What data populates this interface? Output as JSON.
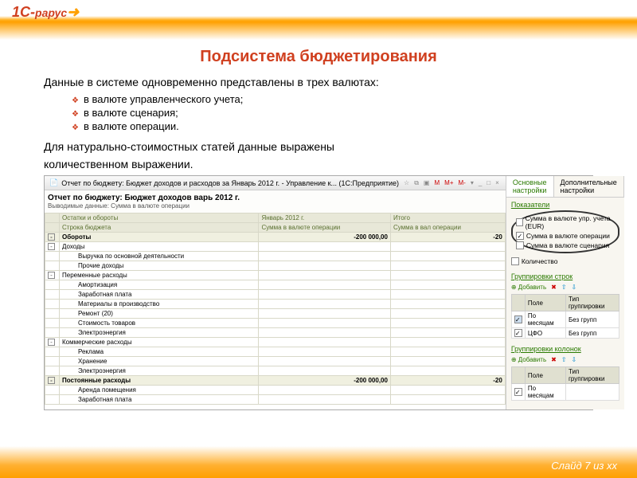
{
  "logo": {
    "main": "1С",
    "sub": "рарус"
  },
  "title": "Подсистема бюджетирования",
  "lead": "Данные в системе одновременно представлены в трех валютах:",
  "bullets": [
    "в валюте управленческого учета;",
    "в валюте сценария;",
    "в валюте операции."
  ],
  "lead2a": "Для натурально-стоимостных статей данные выражены",
  "lead2b": "количественном выражении.",
  "win": {
    "title": "Отчет по бюджету: Бюджет доходов и расходов за Январь 2012 г. - Управление к... (1С:Предприятие)",
    "icons": [
      "☆",
      "⧉",
      "▣",
      "M",
      "M+",
      "M-",
      "▾",
      "_",
      "□",
      "×"
    ]
  },
  "report": {
    "title": "Отчет по бюджету: Бюджет доходов варь 2012 г.",
    "sub": "Выводимые данные: Сумма в валюте операции",
    "cols": {
      "c1": "Остатки и обороты",
      "c2": "Январь 2012 г.",
      "c3": "Итого"
    },
    "cols2": {
      "c1": "Строка бюджета",
      "c2": "Сумма в валюте операции",
      "c3": "Сумма в вал операции"
    },
    "rows": [
      {
        "t": "Обороты",
        "v1": "-200 000,00",
        "v2": "-20",
        "bold": true,
        "tg": "-"
      },
      {
        "t": "Доходы",
        "tg": "-"
      },
      {
        "t": "Выручка по основной деятельности",
        "indent": 2
      },
      {
        "t": "Прочие доходы",
        "indent": 2
      },
      {
        "t": "Переменные расходы",
        "tg": "-"
      },
      {
        "t": "Амортизация",
        "indent": 2
      },
      {
        "t": "Заработная плата",
        "indent": 2
      },
      {
        "t": "Материалы в производство",
        "indent": 2
      },
      {
        "t": "Ремонт (20)",
        "indent": 2
      },
      {
        "t": "Стоимость товаров",
        "indent": 2
      },
      {
        "t": "Электроэнергия",
        "indent": 2
      },
      {
        "t": "Коммерческие расходы",
        "tg": "-"
      },
      {
        "t": "Реклама",
        "indent": 2
      },
      {
        "t": "Хранение",
        "indent": 2
      },
      {
        "t": "Электроэнергия",
        "indent": 2
      },
      {
        "t": "Постоянные расходы",
        "v1": "-200 000,00",
        "v2": "-20",
        "tg": "-",
        "bold": true
      },
      {
        "t": "Аренда помещения",
        "indent": 2
      },
      {
        "t": "Заработная плата",
        "indent": 2
      }
    ]
  },
  "tabs": {
    "t1": "Основные настройки",
    "t2": "Дополнительные настройки"
  },
  "indicators": {
    "label": "Показатели",
    "items": [
      {
        "chk": false,
        "text": "Сумма в валюте упр. учета (EUR)"
      },
      {
        "chk": true,
        "text": "Сумма в валюте операции"
      },
      {
        "chk": false,
        "text": "Сумма в валюте сценария"
      }
    ],
    "qty": "Количество"
  },
  "groupRows": {
    "label": "Группировки строк",
    "add": "Добавить",
    "cols": {
      "c1": "Поле",
      "c2": "Тип группировки"
    },
    "rows": [
      {
        "chk": true,
        "f": "По месяцам",
        "g": "Без групп"
      },
      {
        "chk": true,
        "f": "ЦФО",
        "g": "Без групп"
      }
    ]
  },
  "groupCols": {
    "label": "Группировки колонок",
    "add": "Добавить",
    "cols": {
      "c1": "Поле",
      "c2": "Тип группировки"
    },
    "rows": [
      {
        "chk": true,
        "f": "По месяцам",
        "g": ""
      }
    ]
  },
  "footer": "Слайд 7 из xx"
}
